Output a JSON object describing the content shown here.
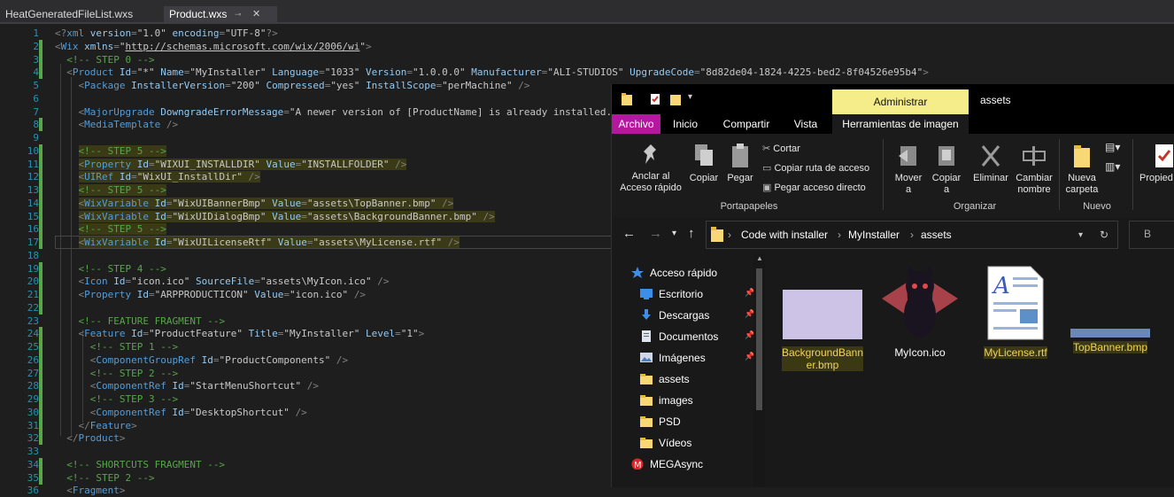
{
  "tabs": [
    {
      "label": "HeatGeneratedFileList.wxs"
    },
    {
      "label": "Product.wxs"
    }
  ],
  "editor_lines": [
    {
      "n": "1",
      "code": [
        [
          "t-br",
          "<?"
        ],
        [
          "t-tag",
          "xml "
        ],
        [
          "t-at",
          "version"
        ],
        [
          "t-br",
          "="
        ],
        [
          "t-q",
          "\"1.0\" "
        ],
        [
          "t-at",
          "encoding"
        ],
        [
          "t-br",
          "="
        ],
        [
          "t-q",
          "\"UTF-8\""
        ],
        [
          "t-br",
          "?>"
        ]
      ]
    },
    {
      "n": "2",
      "code": [
        [
          "t-br",
          "<"
        ],
        [
          "t-tag",
          "Wix "
        ],
        [
          "t-at",
          "xmlns"
        ],
        [
          "t-br",
          "="
        ],
        [
          "t-q",
          "\""
        ],
        [
          "t-url",
          "http://schemas.microsoft.com/wix/2006/wi"
        ],
        [
          "t-q",
          "\""
        ],
        [
          "t-br",
          ">"
        ]
      ]
    },
    {
      "n": "3",
      "code": [
        [
          "",
          "  "
        ],
        [
          "t-com",
          "<!-- STEP 0 -->"
        ]
      ]
    },
    {
      "n": "4",
      "code": [
        [
          "",
          "  "
        ],
        [
          "t-br",
          "<"
        ],
        [
          "t-tag",
          "Product "
        ],
        [
          "t-at",
          "Id"
        ],
        [
          "t-br",
          "="
        ],
        [
          "t-q",
          "\"*\" "
        ],
        [
          "t-at",
          "Name"
        ],
        [
          "t-br",
          "="
        ],
        [
          "t-q",
          "\"MyInstaller\" "
        ],
        [
          "t-at",
          "Language"
        ],
        [
          "t-br",
          "="
        ],
        [
          "t-q",
          "\"1033\" "
        ],
        [
          "t-at",
          "Version"
        ],
        [
          "t-br",
          "="
        ],
        [
          "t-q",
          "\"1.0.0.0\" "
        ],
        [
          "t-at",
          "Manufacturer"
        ],
        [
          "t-br",
          "="
        ],
        [
          "t-q",
          "\"ALI-STUDIOS\" "
        ],
        [
          "t-at",
          "UpgradeCode"
        ],
        [
          "t-br",
          "="
        ],
        [
          "t-q",
          "\"8d82de04-1824-4225-bed2-8f04526e95b4\""
        ],
        [
          "t-br",
          ">"
        ]
      ]
    },
    {
      "n": "5",
      "code": [
        [
          "",
          "    "
        ],
        [
          "t-br",
          "<"
        ],
        [
          "t-tag",
          "Package "
        ],
        [
          "t-at",
          "InstallerVersion"
        ],
        [
          "t-br",
          "="
        ],
        [
          "t-q",
          "\"200\" "
        ],
        [
          "t-at",
          "Compressed"
        ],
        [
          "t-br",
          "="
        ],
        [
          "t-q",
          "\"yes\" "
        ],
        [
          "t-at",
          "InstallScope"
        ],
        [
          "t-br",
          "="
        ],
        [
          "t-q",
          "\"perMachine\" "
        ],
        [
          "t-br",
          "/>"
        ]
      ]
    },
    {
      "n": "6",
      "code": []
    },
    {
      "n": "7",
      "code": [
        [
          "",
          "    "
        ],
        [
          "t-br",
          "<"
        ],
        [
          "t-tag",
          "MajorUpgrade "
        ],
        [
          "t-at",
          "DowngradeErrorMessage"
        ],
        [
          "t-br",
          "="
        ],
        [
          "t-q",
          "\"A newer version of [ProductName] is already installed.\" "
        ],
        [
          "t-br",
          "/>"
        ]
      ]
    },
    {
      "n": "8",
      "code": [
        [
          "",
          "    "
        ],
        [
          "t-br",
          "<"
        ],
        [
          "t-tag",
          "MediaTemplate "
        ],
        [
          "t-br",
          "/>"
        ]
      ]
    },
    {
      "n": "9",
      "code": []
    },
    {
      "n": "10",
      "code": [
        [
          "",
          "    "
        ],
        [
          "t-com hl",
          "<!-- STEP 5 -->"
        ]
      ]
    },
    {
      "n": "11",
      "code": [
        [
          "",
          "    "
        ],
        [
          "t-br hl",
          "<"
        ],
        [
          "t-tag hl",
          "Property "
        ],
        [
          "t-at hl",
          "Id"
        ],
        [
          "t-br hl",
          "="
        ],
        [
          "t-q hl",
          "\"WIXUI_INSTALLDIR\" "
        ],
        [
          "t-at hl",
          "Value"
        ],
        [
          "t-br hl",
          "="
        ],
        [
          "t-q hl",
          "\"INSTALLFOLDER\" "
        ],
        [
          "t-br hl",
          "/>"
        ]
      ]
    },
    {
      "n": "12",
      "code": [
        [
          "",
          "    "
        ],
        [
          "t-br hl",
          "<"
        ],
        [
          "t-tag hl",
          "UIRef "
        ],
        [
          "t-at hl",
          "Id"
        ],
        [
          "t-br hl",
          "="
        ],
        [
          "t-q hl",
          "\"WixUI_InstallDir\" "
        ],
        [
          "t-br hl",
          "/>"
        ]
      ]
    },
    {
      "n": "13",
      "code": [
        [
          "",
          "    "
        ],
        [
          "t-com hl",
          "<!-- STEP 5 -->"
        ]
      ]
    },
    {
      "n": "14",
      "code": [
        [
          "",
          "    "
        ],
        [
          "t-br hl",
          "<"
        ],
        [
          "t-tag hl",
          "WixVariable "
        ],
        [
          "t-at hl",
          "Id"
        ],
        [
          "t-br hl",
          "="
        ],
        [
          "t-q hl",
          "\"WixUIBannerBmp\" "
        ],
        [
          "t-at hl",
          "Value"
        ],
        [
          "t-br hl",
          "="
        ],
        [
          "t-q hl",
          "\"assets\\TopBanner.bmp\" "
        ],
        [
          "t-br hl",
          "/>"
        ]
      ]
    },
    {
      "n": "15",
      "code": [
        [
          "",
          "    "
        ],
        [
          "t-br hl",
          "<"
        ],
        [
          "t-tag hl",
          "WixVariable "
        ],
        [
          "t-at hl",
          "Id"
        ],
        [
          "t-br hl",
          "="
        ],
        [
          "t-q hl",
          "\"WixUIDialogBmp\" "
        ],
        [
          "t-at hl",
          "Value"
        ],
        [
          "t-br hl",
          "="
        ],
        [
          "t-q hl",
          "\"assets\\BackgroundBanner.bmp\" "
        ],
        [
          "t-br hl",
          "/>"
        ]
      ]
    },
    {
      "n": "16",
      "code": [
        [
          "",
          "    "
        ],
        [
          "t-com hl",
          "<!-- STEP 5 -->"
        ]
      ]
    },
    {
      "n": "17",
      "code": [
        [
          "",
          "    "
        ],
        [
          "t-br hl",
          "<"
        ],
        [
          "t-tag hl",
          "WixVariable "
        ],
        [
          "t-at hl",
          "Id"
        ],
        [
          "t-br hl",
          "="
        ],
        [
          "t-q hl",
          "\"WixUILicenseRtf\" "
        ],
        [
          "t-at hl",
          "Value"
        ],
        [
          "t-br hl",
          "="
        ],
        [
          "t-q hl",
          "\"assets\\MyLicense.rtf\" "
        ],
        [
          "t-br hl",
          "/>"
        ]
      ]
    },
    {
      "n": "18",
      "code": []
    },
    {
      "n": "19",
      "code": [
        [
          "",
          "    "
        ],
        [
          "t-com",
          "<!-- STEP 4 -->"
        ]
      ]
    },
    {
      "n": "20",
      "code": [
        [
          "",
          "    "
        ],
        [
          "t-br",
          "<"
        ],
        [
          "t-tag",
          "Icon "
        ],
        [
          "t-at",
          "Id"
        ],
        [
          "t-br",
          "="
        ],
        [
          "t-q",
          "\"icon.ico\" "
        ],
        [
          "t-at",
          "SourceFile"
        ],
        [
          "t-br",
          "="
        ],
        [
          "t-q",
          "\"assets\\MyIcon.ico\" "
        ],
        [
          "t-br",
          "/>"
        ]
      ]
    },
    {
      "n": "21",
      "code": [
        [
          "",
          "    "
        ],
        [
          "t-br",
          "<"
        ],
        [
          "t-tag",
          "Property "
        ],
        [
          "t-at",
          "Id"
        ],
        [
          "t-br",
          "="
        ],
        [
          "t-q",
          "\"ARPPRODUCTICON\" "
        ],
        [
          "t-at",
          "Value"
        ],
        [
          "t-br",
          "="
        ],
        [
          "t-q",
          "\"icon.ico\" "
        ],
        [
          "t-br",
          "/>"
        ]
      ]
    },
    {
      "n": "22",
      "code": []
    },
    {
      "n": "23",
      "code": [
        [
          "",
          "    "
        ],
        [
          "t-com",
          "<!-- FEATURE FRAGMENT -->"
        ]
      ]
    },
    {
      "n": "24",
      "code": [
        [
          "",
          "    "
        ],
        [
          "t-br",
          "<"
        ],
        [
          "t-tag",
          "Feature "
        ],
        [
          "t-at",
          "Id"
        ],
        [
          "t-br",
          "="
        ],
        [
          "t-q",
          "\"ProductFeature\" "
        ],
        [
          "t-at",
          "Title"
        ],
        [
          "t-br",
          "="
        ],
        [
          "t-q",
          "\"MyInstaller\" "
        ],
        [
          "t-at",
          "Level"
        ],
        [
          "t-br",
          "="
        ],
        [
          "t-q",
          "\"1\""
        ],
        [
          "t-br",
          ">"
        ]
      ]
    },
    {
      "n": "25",
      "code": [
        [
          "",
          "      "
        ],
        [
          "t-com",
          "<!-- STEP 1 -->"
        ]
      ]
    },
    {
      "n": "26",
      "code": [
        [
          "",
          "      "
        ],
        [
          "t-br",
          "<"
        ],
        [
          "t-tag",
          "ComponentGroupRef "
        ],
        [
          "t-at",
          "Id"
        ],
        [
          "t-br",
          "="
        ],
        [
          "t-q",
          "\"ProductComponents\" "
        ],
        [
          "t-br",
          "/>"
        ]
      ]
    },
    {
      "n": "27",
      "code": [
        [
          "",
          "      "
        ],
        [
          "t-com",
          "<!-- STEP 2 -->"
        ]
      ]
    },
    {
      "n": "28",
      "code": [
        [
          "",
          "      "
        ],
        [
          "t-br",
          "<"
        ],
        [
          "t-tag",
          "ComponentRef "
        ],
        [
          "t-at",
          "Id"
        ],
        [
          "t-br",
          "="
        ],
        [
          "t-q",
          "\"StartMenuShortcut\" "
        ],
        [
          "t-br",
          "/>"
        ]
      ]
    },
    {
      "n": "29",
      "code": [
        [
          "",
          "      "
        ],
        [
          "t-com",
          "<!-- STEP 3 -->"
        ]
      ]
    },
    {
      "n": "30",
      "code": [
        [
          "",
          "      "
        ],
        [
          "t-br",
          "<"
        ],
        [
          "t-tag",
          "ComponentRef "
        ],
        [
          "t-at",
          "Id"
        ],
        [
          "t-br",
          "="
        ],
        [
          "t-q",
          "\"DesktopShortcut\" "
        ],
        [
          "t-br",
          "/>"
        ]
      ]
    },
    {
      "n": "31",
      "code": [
        [
          "",
          "    "
        ],
        [
          "t-br",
          "</"
        ],
        [
          "t-tag",
          "Feature"
        ],
        [
          "t-br",
          ">"
        ]
      ]
    },
    {
      "n": "32",
      "code": [
        [
          "",
          "  "
        ],
        [
          "t-br",
          "</"
        ],
        [
          "t-tag",
          "Product"
        ],
        [
          "t-br",
          ">"
        ]
      ]
    },
    {
      "n": "33",
      "code": []
    },
    {
      "n": "34",
      "code": [
        [
          "",
          "  "
        ],
        [
          "t-com",
          "<!-- SHORTCUTS FRAGMENT -->"
        ]
      ]
    },
    {
      "n": "35",
      "code": [
        [
          "",
          "  "
        ],
        [
          "t-com",
          "<!-- STEP 2 -->"
        ]
      ]
    },
    {
      "n": "36",
      "code": [
        [
          "",
          "  "
        ],
        [
          "t-br",
          "<"
        ],
        [
          "t-tag",
          "Fragment"
        ],
        [
          "t-br",
          ">"
        ]
      ]
    }
  ],
  "explorer": {
    "context_tab": "Administrar",
    "window_title": "assets",
    "ribbon_tabs": [
      "Archivo",
      "Inicio",
      "Compartir",
      "Vista",
      "Herramientas de imagen"
    ],
    "ribbon": {
      "pin_label": "Anclar al\nAcceso rápido",
      "copy_label": "Copiar",
      "paste_label": "Pegar",
      "cut_label": "Cortar",
      "copy_path_label": "Copiar ruta de acceso",
      "paste_shortcut_label": "Pegar acceso directo",
      "group_clipboard": "Portapapeles",
      "move_label": "Mover\na",
      "copyto_label": "Copiar\na",
      "delete_label": "Eliminar",
      "rename_label": "Cambiar\nnombre",
      "group_organize": "Organizar",
      "new_folder_label": "Nueva\ncarpeta",
      "group_new": "Nuevo",
      "props_label": "Propied"
    },
    "breadcrumb": [
      "Code with installer",
      "MyInstaller",
      "assets"
    ],
    "search_placeholder": "B",
    "nav": [
      {
        "label": "Acceso rápido",
        "icon": "star-icon",
        "pinned": false
      },
      {
        "label": "Escritorio",
        "icon": "desktop-icon",
        "pinned": true
      },
      {
        "label": "Descargas",
        "icon": "download-icon",
        "pinned": true
      },
      {
        "label": "Documentos",
        "icon": "documents-icon",
        "pinned": true
      },
      {
        "label": "Imágenes",
        "icon": "pictures-icon",
        "pinned": true
      },
      {
        "label": "assets",
        "icon": "folder-icon",
        "pinned": false
      },
      {
        "label": "images",
        "icon": "folder-icon",
        "pinned": false
      },
      {
        "label": "PSD",
        "icon": "folder-icon",
        "pinned": false
      },
      {
        "label": "Vídeos",
        "icon": "folder-icon",
        "pinned": false
      },
      {
        "label": "MEGAsync",
        "icon": "mega-icon",
        "pinned": false
      }
    ],
    "files": [
      {
        "name": "BackgroundBanner.bmp",
        "line1": "BackgroundBann",
        "line2": "er.bmp",
        "highlight": true
      },
      {
        "name": "MyIcon.ico",
        "line1": "MyIcon.ico",
        "line2": "",
        "highlight": false
      },
      {
        "name": "MyLicense.rtf",
        "line1": "MyLicense.rtf",
        "line2": "",
        "highlight": true
      },
      {
        "name": "TopBanner.bmp",
        "line1": "TopBanner.bmp",
        "line2": "",
        "highlight": true
      }
    ]
  },
  "colors": {
    "accent_file_tab": "#b5179e",
    "context_tab": "#f5ec8a",
    "highlight_text": "#f2d35a"
  }
}
